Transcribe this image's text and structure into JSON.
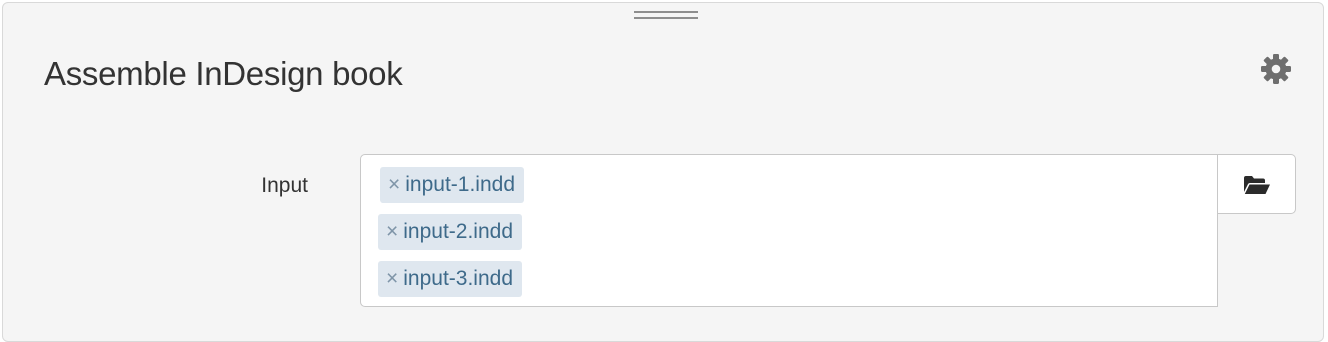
{
  "panel": {
    "title": "Assemble InDesign book",
    "settings_icon": "gear-icon",
    "drag_icon": "drag-handle-icon"
  },
  "input_field": {
    "label": "Input",
    "remove_glyph": "×",
    "tags": [
      {
        "label": "input-1.indd"
      },
      {
        "label": "input-2.indd"
      },
      {
        "label": "input-3.indd"
      }
    ],
    "browse_icon": "folder-open-icon"
  },
  "colors": {
    "panel_background": "#f5f5f5",
    "tag_background": "#dfe7ef",
    "tag_text": "#3e6a8a",
    "icon": "#6e6e6e"
  }
}
